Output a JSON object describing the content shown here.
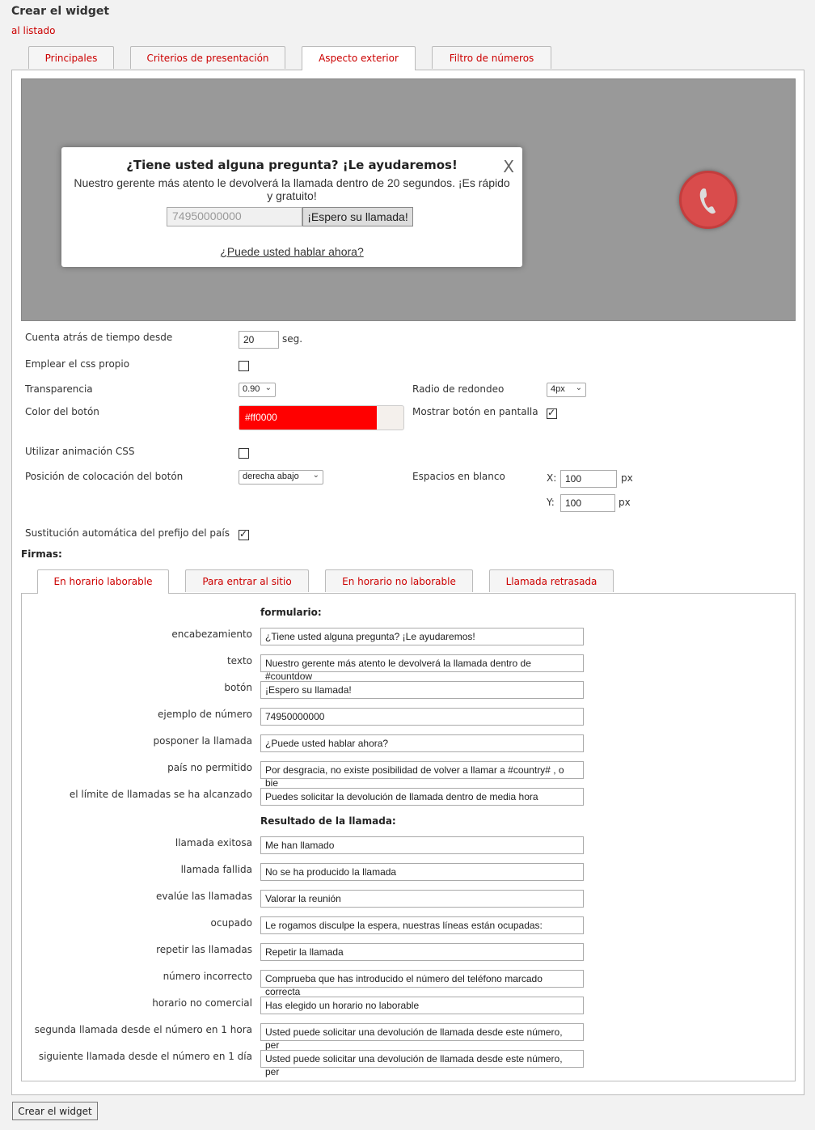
{
  "page": {
    "title": "Crear el widget",
    "back_link": "al listado"
  },
  "tabs": [
    "Principales",
    "Criterios de presentación",
    "Aspecto exterior",
    "Filtro de números"
  ],
  "preview": {
    "title": "¿Tiene usted alguna pregunta? ¡Le ayudaremos!",
    "close": "X",
    "text": "Nuestro gerente más atento le devolverá la llamada dentro de 20 segundos. ¡Es rápido y gratuito!",
    "phone_placeholder": "74950000000",
    "submit": "¡Espero su llamada!",
    "postpone": "¿Puede usted hablar ahora?",
    "call_icon": "phone-icon"
  },
  "settings": {
    "countdown_label": "Cuenta atrás de tiempo desde",
    "countdown_value": "20",
    "countdown_unit": "seg.",
    "own_css_label": "Emplear el css propio",
    "own_css_checked": false,
    "transparency_label": "Transparencia",
    "transparency_value": "0.90",
    "radius_label": "Radio de redondeo",
    "radius_value": "4px",
    "button_color_label": "Color del botón",
    "button_color_value": "#ff0000",
    "show_button_label": "Mostrar botón en pantalla",
    "show_button_checked": true,
    "css_anim_label": "Utilizar animación CSS",
    "css_anim_checked": false,
    "position_label": "Posición de colocación del botón",
    "position_value": "derecha abajo",
    "spaces_label": "Espacios en blanco",
    "x_label": "X:",
    "x_value": "100",
    "y_label": "Y:",
    "y_value": "100",
    "px": "px",
    "prefix_label": "Sustitución automática del prefijo del país",
    "prefix_checked": true
  },
  "firmas": {
    "label": "Firmas:",
    "tabs": [
      "En horario laborable",
      "Para entrar al sitio",
      "En horario no laborable",
      "Llamada retrasada"
    ],
    "form_heading": "formulario:",
    "form_fields": [
      {
        "label": "encabezamiento",
        "value": "¿Tiene usted alguna pregunta? ¡Le ayudaremos!"
      },
      {
        "label": "texto",
        "value": "Nuestro gerente más atento le devolverá la llamada dentro de #countdow"
      },
      {
        "label": "botón",
        "value": "¡Espero su llamada!"
      },
      {
        "label": "ejemplo de número",
        "value": "74950000000"
      },
      {
        "label": "posponer la llamada",
        "value": "¿Puede usted hablar ahora?"
      },
      {
        "label": "país no permitido",
        "value": "Por desgracia, no existe posibilidad de volver a llamar a #country# , o bie"
      },
      {
        "label": "el límite de llamadas se ha alcanzado",
        "value": "Puedes solicitar la devolución de llamada dentro de media hora"
      }
    ],
    "result_heading": "Resultado de la llamada:",
    "result_fields": [
      {
        "label": "llamada exitosa",
        "value": "Me han llamado"
      },
      {
        "label": "llamada fallida",
        "value": "No se ha producido la llamada"
      },
      {
        "label": "evalúe las llamadas",
        "value": "Valorar la reunión"
      },
      {
        "label": "ocupado",
        "value": "Le rogamos disculpe la espera, nuestras líneas están ocupadas:"
      },
      {
        "label": "repetir las llamadas",
        "value": "Repetir la llamada"
      },
      {
        "label": "número incorrecto",
        "value": "Comprueba que has introducido el número del teléfono marcado correcta"
      },
      {
        "label": "horario no comercial",
        "value": "Has elegido un horario no laborable"
      },
      {
        "label": "segunda llamada desde el número en 1 hora",
        "value": "Usted puede solicitar una devolución de llamada desde este número, per"
      },
      {
        "label": "siguiente llamada desde el número en 1 día",
        "value": "Usted puede solicitar una devolución de llamada desde este número, per"
      }
    ]
  },
  "actions": {
    "create": "Crear el widget"
  }
}
